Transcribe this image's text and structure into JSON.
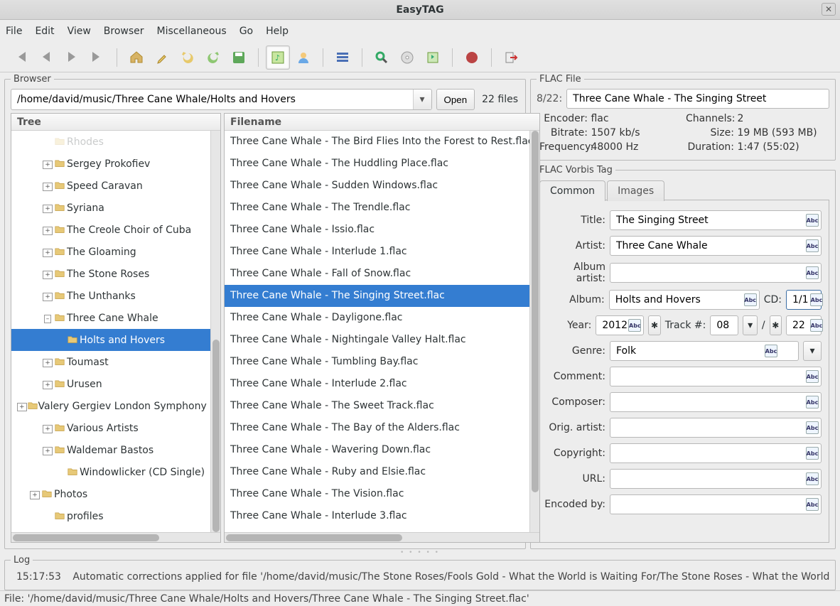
{
  "app": {
    "title": "EasyTAG"
  },
  "menubar": [
    "File",
    "Edit",
    "View",
    "Browser",
    "Miscellaneous",
    "Go",
    "Help"
  ],
  "toolbar": {
    "buttons": [
      {
        "name": "nav-first-icon",
        "dim": true
      },
      {
        "name": "nav-prev-icon",
        "dim": true
      },
      {
        "name": "nav-next-icon",
        "dim": true
      },
      {
        "name": "nav-last-icon",
        "dim": true
      },
      {
        "name": "sep"
      },
      {
        "name": "home-icon"
      },
      {
        "name": "brush-icon"
      },
      {
        "name": "undo-icon"
      },
      {
        "name": "redo-icon"
      },
      {
        "name": "save-icon"
      },
      {
        "name": "sep"
      },
      {
        "name": "tree-view-icon",
        "active": true
      },
      {
        "name": "artist-view-icon"
      },
      {
        "name": "sep"
      },
      {
        "name": "select-all-icon"
      },
      {
        "name": "sep"
      },
      {
        "name": "search-icon"
      },
      {
        "name": "cddb-icon"
      },
      {
        "name": "playlist-icon"
      },
      {
        "name": "sep"
      },
      {
        "name": "run-icon"
      },
      {
        "name": "sep"
      },
      {
        "name": "quit-icon"
      }
    ]
  },
  "browser": {
    "legend": "Browser",
    "path": "/home/david/music/Three Cane Whale/Holts and Hovers",
    "open_label": "Open",
    "file_count": "22 files",
    "tree_header": "Tree",
    "filename_header": "Filename",
    "tree": [
      {
        "depth": 2,
        "exp": null,
        "label": "Rhodes",
        "fade": true
      },
      {
        "depth": 2,
        "exp": "+",
        "label": "Sergey Prokofiev"
      },
      {
        "depth": 2,
        "exp": "+",
        "label": "Speed Caravan"
      },
      {
        "depth": 2,
        "exp": "+",
        "label": "Syriana"
      },
      {
        "depth": 2,
        "exp": "+",
        "label": "The Creole Choir of Cuba"
      },
      {
        "depth": 2,
        "exp": "+",
        "label": "The Gloaming"
      },
      {
        "depth": 2,
        "exp": "+",
        "label": "The Stone Roses"
      },
      {
        "depth": 2,
        "exp": "+",
        "label": "The Unthanks"
      },
      {
        "depth": 2,
        "exp": "–",
        "label": "Three Cane Whale"
      },
      {
        "depth": 3,
        "exp": null,
        "label": "Holts and Hovers",
        "selected": true
      },
      {
        "depth": 2,
        "exp": "+",
        "label": "Toumast"
      },
      {
        "depth": 2,
        "exp": "+",
        "label": "Urusen"
      },
      {
        "depth": 2,
        "exp": "+",
        "label": "Valery Gergiev London Symphony Orchestra"
      },
      {
        "depth": 2,
        "exp": "+",
        "label": "Various Artists"
      },
      {
        "depth": 2,
        "exp": "+",
        "label": "Waldemar Bastos"
      },
      {
        "depth": 3,
        "exp": null,
        "label": "Windowlicker (CD Single)"
      },
      {
        "depth": 1,
        "exp": "+",
        "label": "Photos"
      },
      {
        "depth": 2,
        "exp": null,
        "label": "profiles"
      }
    ],
    "files": [
      "Three Cane Whale - The Bird Flies Into the Forest to Rest.flac",
      "Three Cane Whale - The Huddling Place.flac",
      "Three Cane Whale - Sudden Windows.flac",
      "Three Cane Whale - The Trendle.flac",
      "Three Cane Whale - Issio.flac",
      "Three Cane Whale - Interlude 1.flac",
      "Three Cane Whale - Fall of Snow.flac",
      "Three Cane Whale - The Singing Street.flac",
      "Three Cane Whale - Dayligone.flac",
      "Three Cane Whale - Nightingale Valley Halt.flac",
      "Three Cane Whale - Tumbling Bay.flac",
      "Three Cane Whale - Interlude 2.flac",
      "Three Cane Whale - The Sweet Track.flac",
      "Three Cane Whale - The Bay of the Alders.flac",
      "Three Cane Whale - Wavering Down.flac",
      "Three Cane Whale - Ruby and Elsie.flac",
      "Three Cane Whale - The Vision.flac",
      "Three Cane Whale - Interlude 3.flac"
    ],
    "selected_file_index": 7
  },
  "flac_file": {
    "legend": "FLAC File",
    "index": "8/22:",
    "name": "Three Cane Whale - The Singing Street",
    "meta": {
      "Encoder": "flac",
      "Channels": "2",
      "Bitrate": "1507 kb/s",
      "Size": "19 MB (593 MB)",
      "Frequency": "48000 Hz",
      "Duration": "1:47 (55:02)"
    }
  },
  "vorbis": {
    "legend": "FLAC Vorbis Tag",
    "tabs": [
      "Common",
      "Images"
    ],
    "active_tab": 0,
    "labels": {
      "title": "Title:",
      "artist": "Artist:",
      "album_artist": "Album artist:",
      "album": "Album:",
      "cd": "CD:",
      "year": "Year:",
      "track": "Track #:",
      "genre": "Genre:",
      "comment": "Comment:",
      "composer": "Composer:",
      "orig_artist": "Orig. artist:",
      "copyright": "Copyright:",
      "url": "URL:",
      "encoded_by": "Encoded by:"
    },
    "values": {
      "title": "The Singing Street",
      "artist": "Three Cane Whale",
      "album_artist": "",
      "album": "Holts and Hovers",
      "cd": "1/1",
      "year": "2012",
      "track": "08",
      "track_total": "22",
      "genre": "Folk",
      "comment": "",
      "composer": "",
      "orig_artist": "",
      "copyright": "",
      "url": "",
      "encoded_by": ""
    }
  },
  "log": {
    "legend": "Log",
    "time": "15:17:53",
    "message": "Automatic corrections applied for file '/home/david/music/The Stone Roses/Fools Gold - What the World is Waiting For/The Stone Roses - What the World is Waiting F"
  },
  "statusbar": "File: '/home/david/music/Three Cane Whale/Holts and Hovers/Three Cane Whale - The Singing Street.flac'"
}
